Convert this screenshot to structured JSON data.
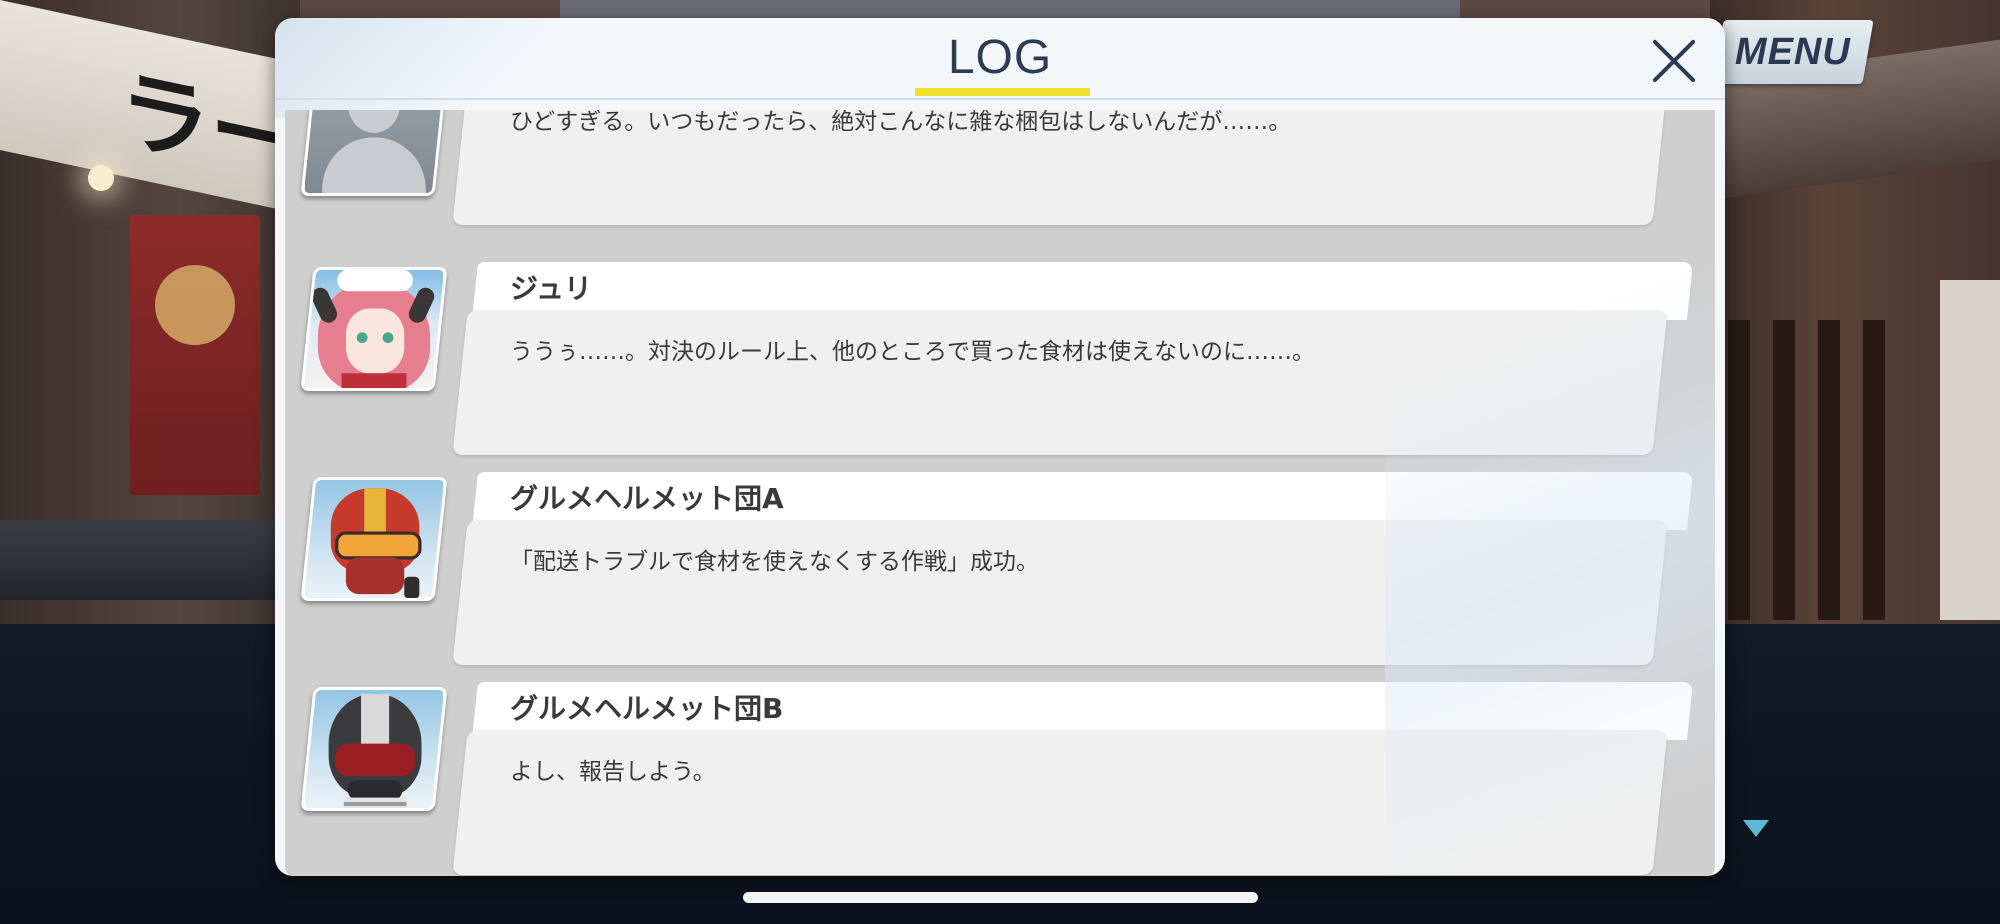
{
  "header": {
    "title": "LOG"
  },
  "menu": {
    "label": "MENU"
  },
  "log": {
    "entries": [
      {
        "speaker": "",
        "avatar": "placeholder-silhouette-icon",
        "text": "ひどすぎる。いつもだったら、絶対こんなに雑な梱包はしないんだが……。"
      },
      {
        "speaker": "ジュリ",
        "avatar": "juri-portrait",
        "text": "ううぅ……。対決のルール上、他のところで買った食材は使えないのに……。"
      },
      {
        "speaker": "グルメヘルメット団A",
        "avatar": "gourmet-helmet-a-portrait",
        "text": "「配送トラブルで食材を使えなくする作戦」成功。"
      },
      {
        "speaker": "グルメヘルメット団B",
        "avatar": "gourmet-helmet-b-portrait",
        "text": "よし、報告しよう。"
      }
    ]
  },
  "colors": {
    "title": "#2b3d55",
    "title_underline": "#f1e02e",
    "scroll_arrow": "#5fb8d6"
  }
}
